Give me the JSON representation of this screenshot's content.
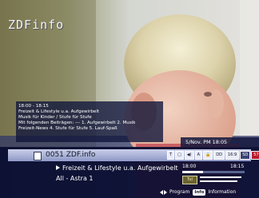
{
  "tv": {
    "logo": "ZDFinfo"
  },
  "info_panel": {
    "lines": [
      "18:00 - 18:15",
      "Freizeit & Lifestyle u.a. Aufgewirbelt",
      "Musik für Kinder / Stufe für Stufe",
      "Mit folgenden Beiträgen: --- 1. Aufgewirbelt 2. Musik",
      "Freizeit-News 4. Stufe für Stufe 5. Lauf-Spaß"
    ]
  },
  "datetime": "5/Nov. PM 18:05",
  "banner": {
    "channel": "0051 ZDF.info",
    "badges": [
      "T",
      "▢",
      "◀)",
      "A",
      "🔒",
      "DD",
      "16:9",
      "SD",
      "576i"
    ],
    "program": "Freizeit & Lifestyle u.a. Aufgewirbelt",
    "source": "All - Astra 1",
    "time_start": "18:00",
    "time_end": "18:15",
    "progress_pct": 33,
    "signal_label": "Tul",
    "signal_strength_pct": 92,
    "signal_quality_pct": 84,
    "hint_program": "Program",
    "hint_info_key": "Info",
    "hint_information": "Information"
  },
  "colors": {
    "panel": "#12163c",
    "bar": "#c9cfe8",
    "accent_red": "#b81b2b"
  }
}
